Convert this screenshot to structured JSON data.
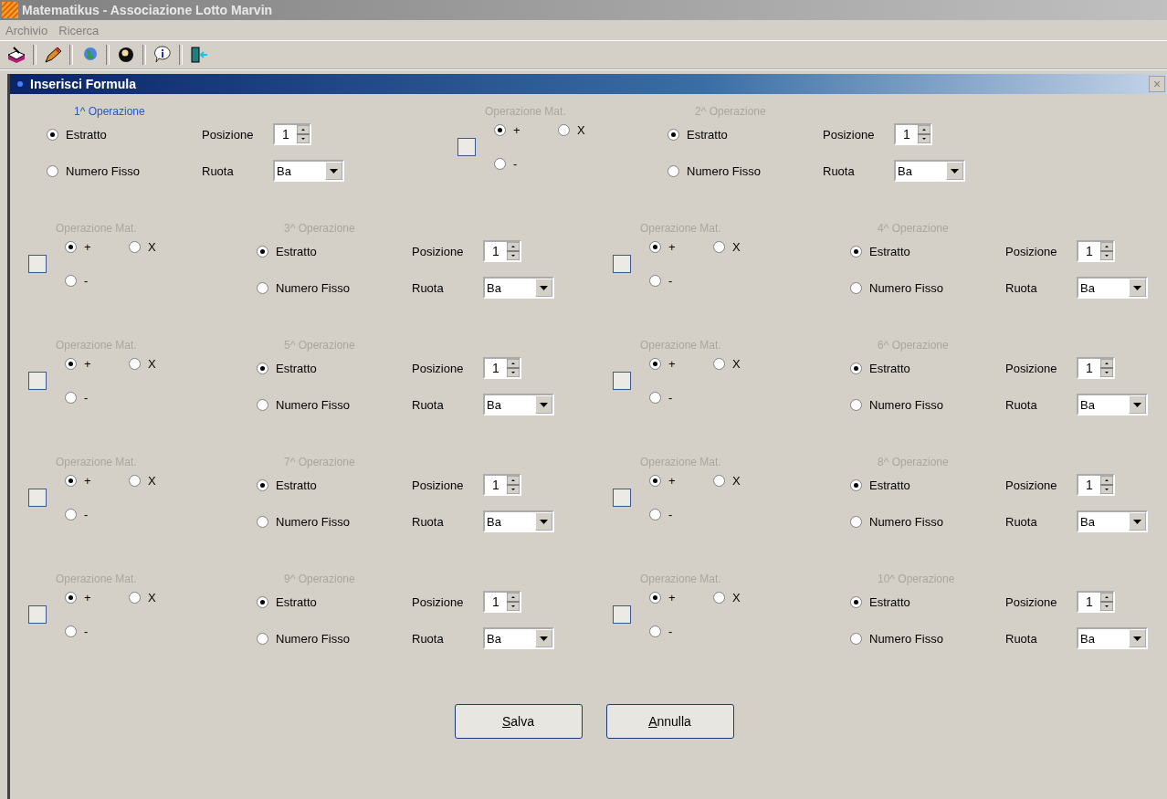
{
  "window": {
    "title": "Matematikus - Associazione Lotto Marvin"
  },
  "menu": [
    "Archivio",
    "Ricerca"
  ],
  "toolbar": [
    {
      "kind": "tray"
    },
    {
      "kind": "pencil"
    },
    {
      "kind": "globe"
    },
    {
      "kind": "ball"
    },
    {
      "kind": "info"
    },
    {
      "kind": "exit"
    }
  ],
  "dialog": {
    "title": "Inserisci Formula",
    "close": "×"
  },
  "operations": [
    {
      "title": "1^ Operazione",
      "disabled": false,
      "options": [
        {
          "label": "Estratto",
          "selected": true
        },
        {
          "label": "Numero Fisso",
          "selected": false
        }
      ],
      "posizione_label": "Posizione",
      "posizione": "1",
      "ruota_label": "Ruota",
      "ruota": "Ba"
    },
    {
      "title": "2^ Operazione",
      "disabled": true,
      "options": [
        {
          "label": "Estratto",
          "selected": true
        },
        {
          "label": "Numero Fisso",
          "selected": false
        }
      ],
      "posizione_label": "Posizione",
      "posizione": "1",
      "ruota_label": "Ruota",
      "ruota": "Ba"
    },
    {
      "title": "3^ Operazione",
      "disabled": true,
      "options": [
        {
          "label": "Estratto",
          "selected": true
        },
        {
          "label": "Numero Fisso",
          "selected": false
        }
      ],
      "posizione_label": "Posizione",
      "posizione": "1",
      "ruota_label": "Ruota",
      "ruota": "Ba"
    },
    {
      "title": "4^ Operazione",
      "disabled": true,
      "options": [
        {
          "label": "Estratto",
          "selected": true
        },
        {
          "label": "Numero Fisso",
          "selected": false
        }
      ],
      "posizione_label": "Posizione",
      "posizione": "1",
      "ruota_label": "Ruota",
      "ruota": "Ba"
    },
    {
      "title": "5^ Operazione",
      "disabled": true,
      "options": [
        {
          "label": "Estratto",
          "selected": true
        },
        {
          "label": "Numero Fisso",
          "selected": false
        }
      ],
      "posizione_label": "Posizione",
      "posizione": "1",
      "ruota_label": "Ruota",
      "ruota": "Ba"
    },
    {
      "title": "6^ Operazione",
      "disabled": true,
      "options": [
        {
          "label": "Estratto",
          "selected": true
        },
        {
          "label": "Numero Fisso",
          "selected": false
        }
      ],
      "posizione_label": "Posizione",
      "posizione": "1",
      "ruota_label": "Ruota",
      "ruota": "Ba"
    },
    {
      "title": "7^ Operazione",
      "disabled": true,
      "options": [
        {
          "label": "Estratto",
          "selected": true
        },
        {
          "label": "Numero Fisso",
          "selected": false
        }
      ],
      "posizione_label": "Posizione",
      "posizione": "1",
      "ruota_label": "Ruota",
      "ruota": "Ba"
    },
    {
      "title": "8^ Operazione",
      "disabled": true,
      "options": [
        {
          "label": "Estratto",
          "selected": true
        },
        {
          "label": "Numero Fisso",
          "selected": false
        }
      ],
      "posizione_label": "Posizione",
      "posizione": "1",
      "ruota_label": "Ruota",
      "ruota": "Ba"
    },
    {
      "title": "9^ Operazione",
      "disabled": true,
      "options": [
        {
          "label": "Estratto",
          "selected": true
        },
        {
          "label": "Numero Fisso",
          "selected": false
        }
      ],
      "posizione_label": "Posizione",
      "posizione": "1",
      "ruota_label": "Ruota",
      "ruota": "Ba"
    },
    {
      "title": "10^ Operazione",
      "disabled": true,
      "options": [
        {
          "label": "Estratto",
          "selected": true
        },
        {
          "label": "Numero Fisso",
          "selected": false
        }
      ],
      "posizione_label": "Posizione",
      "posizione": "1",
      "ruota_label": "Ruota",
      "ruota": "Ba"
    }
  ],
  "math_operations": [
    {
      "title": "Operazione Mat.",
      "disabled": true,
      "checked": false,
      "options": [
        {
          "label": "+",
          "selected": true
        },
        {
          "label": "X",
          "selected": false
        },
        {
          "label": "-",
          "selected": false
        }
      ]
    },
    {
      "title": "Operazione Mat.",
      "disabled": true,
      "checked": false,
      "options": [
        {
          "label": "+",
          "selected": true
        },
        {
          "label": "X",
          "selected": false
        },
        {
          "label": "-",
          "selected": false
        }
      ]
    },
    {
      "title": "Operazione Mat.",
      "disabled": true,
      "checked": false,
      "options": [
        {
          "label": "+",
          "selected": true
        },
        {
          "label": "X",
          "selected": false
        },
        {
          "label": "-",
          "selected": false
        }
      ]
    },
    {
      "title": "Operazione Mat.",
      "disabled": true,
      "checked": false,
      "options": [
        {
          "label": "+",
          "selected": true
        },
        {
          "label": "X",
          "selected": false
        },
        {
          "label": "-",
          "selected": false
        }
      ]
    },
    {
      "title": "Operazione Mat.",
      "disabled": true,
      "checked": false,
      "options": [
        {
          "label": "+",
          "selected": true
        },
        {
          "label": "X",
          "selected": false
        },
        {
          "label": "-",
          "selected": false
        }
      ]
    },
    {
      "title": "Operazione Mat.",
      "disabled": true,
      "checked": false,
      "options": [
        {
          "label": "+",
          "selected": true
        },
        {
          "label": "X",
          "selected": false
        },
        {
          "label": "-",
          "selected": false
        }
      ]
    },
    {
      "title": "Operazione Mat.",
      "disabled": true,
      "checked": false,
      "options": [
        {
          "label": "+",
          "selected": true
        },
        {
          "label": "X",
          "selected": false
        },
        {
          "label": "-",
          "selected": false
        }
      ]
    },
    {
      "title": "Operazione Mat.",
      "disabled": true,
      "checked": false,
      "options": [
        {
          "label": "+",
          "selected": true
        },
        {
          "label": "X",
          "selected": false
        },
        {
          "label": "-",
          "selected": false
        }
      ]
    },
    {
      "title": "Operazione Mat.",
      "disabled": true,
      "checked": false,
      "options": [
        {
          "label": "+",
          "selected": true
        },
        {
          "label": "X",
          "selected": false
        },
        {
          "label": "-",
          "selected": false
        }
      ]
    }
  ],
  "buttons": [
    "Salva",
    "Annulla"
  ]
}
